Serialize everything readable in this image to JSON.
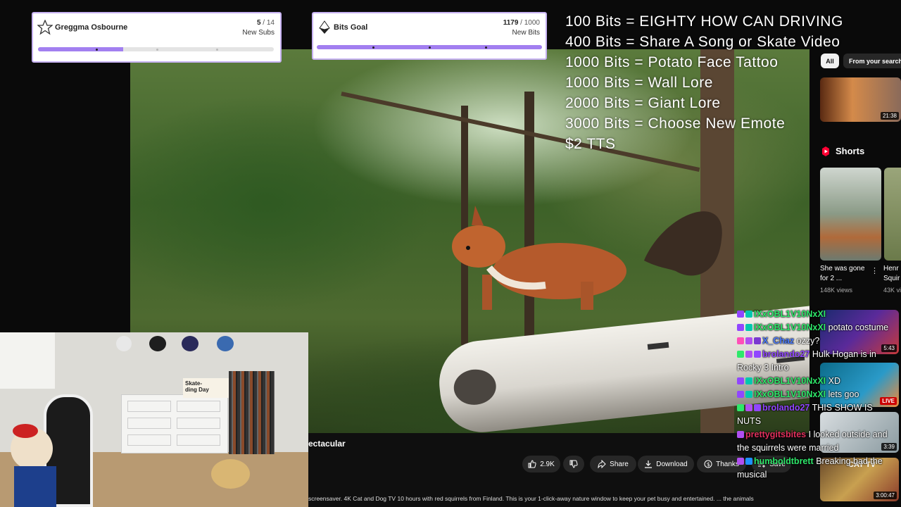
{
  "goals": [
    {
      "title": "Greggma Osbourne",
      "current": "5",
      "total": " / 14",
      "subtitle": "New Subs",
      "progress": 0.36
    },
    {
      "title": "Bits Goal",
      "current": "1179",
      "total": " / 1000",
      "subtitle": "New Bits",
      "progress": 1.0
    }
  ],
  "bits_menu": [
    "100 Bits = EIGHTY HOW CAN DRIVING",
    "400 Bits = Share A Song or Skate Video",
    "1000 Bits = Potato Face Tattoo",
    "1000 Bits = Wall Lore",
    "2000 Bits = Giant Lore",
    "3000 Bits = Choose New Emote",
    "$2 TTS"
  ],
  "youtube": {
    "video_title_fragment": "ectacular",
    "description": "screensaver. 4K Cat and Dog TV 10 hours with red squirrels from Finland. This is your 1-click-away nature window to keep your pet busy and entertained. ... the animals",
    "like_count": "2.9K",
    "share_label": "Share",
    "download_label": "Download",
    "thanks_label": "Thanks",
    "save_label": "Save",
    "chips": [
      "All",
      "From your search"
    ],
    "sidebar_first_duration": "21:38",
    "shorts_heading": "Shorts",
    "shorts": [
      {
        "title": "She was gone for 2 ...",
        "views": "148K views"
      },
      {
        "title": "Henr Squir",
        "views": "43K vi"
      }
    ],
    "sidebar_durations": [
      "5:43",
      "LIVE",
      "3:39",
      "3:00:47"
    ],
    "sidebar_overlay_text": "CAT TV"
  },
  "webcam_sign": "Skate-\nding Day",
  "chat": [
    {
      "user": "IXxOBL1V10NxXI",
      "msg": "",
      "color": "#2ee86a"
    },
    {
      "user": "IXxOBL1V10NxXI",
      "msg": "potato costume",
      "color": "#2ee86a"
    },
    {
      "user": "X_Chaz",
      "msg": "ozzy?",
      "color": "#4a7bff"
    },
    {
      "user": "brolando27",
      "msg": "Hulk Hogan is in Rocky 3 Intro",
      "color": "#9146ff"
    },
    {
      "user": "IXxOBL1V10NxXI",
      "msg": "XD",
      "color": "#2ee86a"
    },
    {
      "user": "IXxOBL1V10NxXI",
      "msg": "lets goo",
      "color": "#2ee86a"
    },
    {
      "user": "brolando27",
      "msg": "THIS SHOW IS NUTS",
      "color": "#9146ff"
    },
    {
      "user": "prettygitsbites",
      "msg": "I looked outside and the squirrels were married",
      "color": "#e0305c"
    },
    {
      "user": "humboldtbrett",
      "msg": "Breaking bad the musical",
      "color": "#2ee86a"
    }
  ]
}
